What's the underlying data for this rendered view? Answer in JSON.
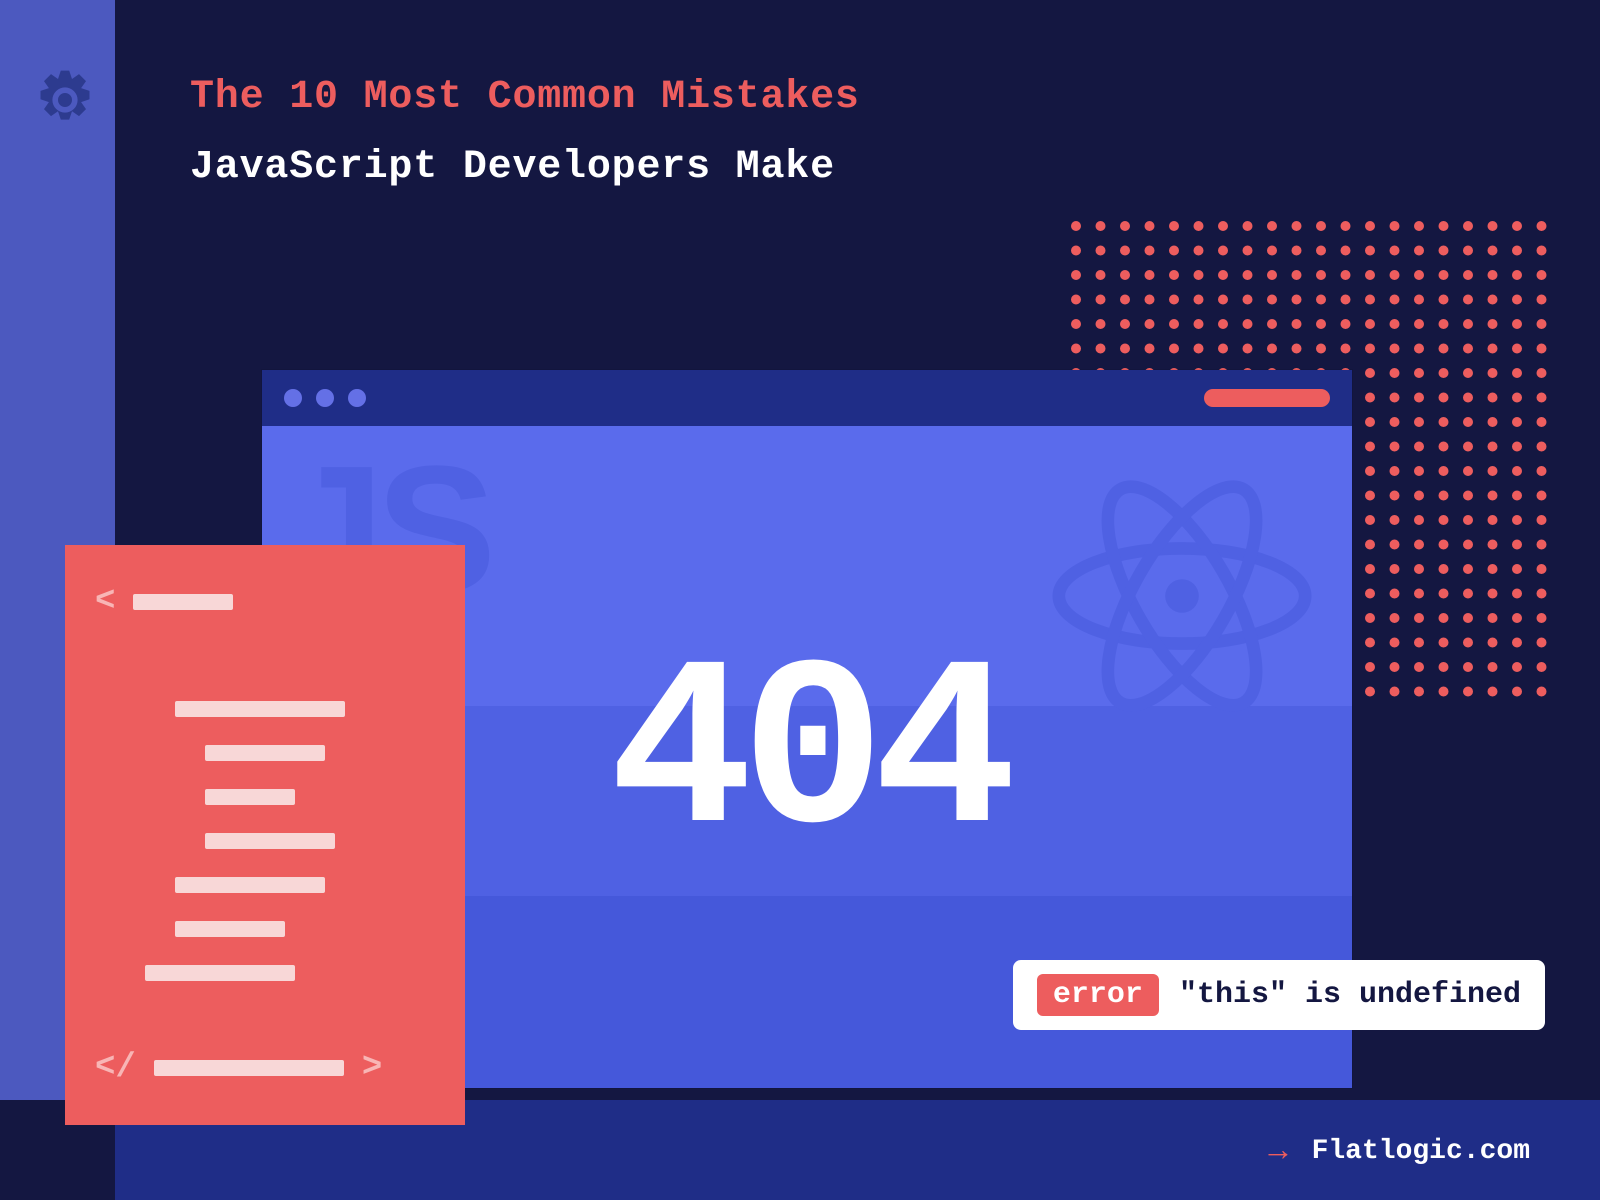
{
  "title": {
    "line1": "The 10 Most Common Mistakes",
    "line2": "JavaScript Developers Make"
  },
  "browser": {
    "js_label": "JS",
    "error_code": "404"
  },
  "code": {
    "open_bracket": "<",
    "close_bracket": "</",
    "close_arrow": ">"
  },
  "error": {
    "badge": "error",
    "message": "\"this\" is undefined"
  },
  "footer": {
    "arrow": "→",
    "site": "Flatlogic.com"
  }
}
